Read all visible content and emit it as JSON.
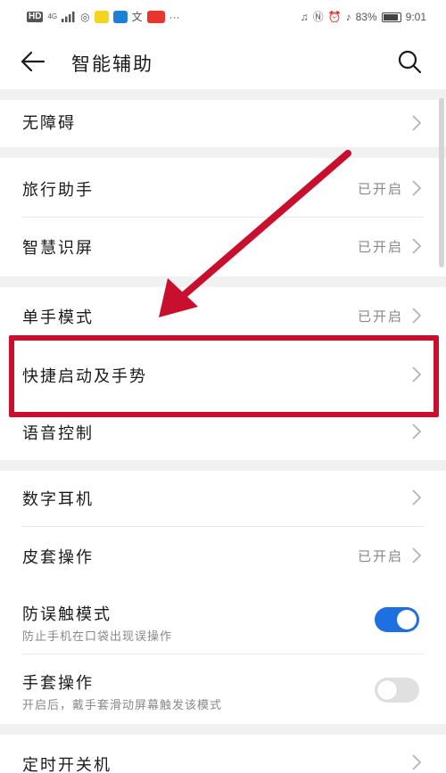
{
  "status_bar": {
    "left_text": "HD",
    "signal": "4G",
    "battery_percent": "83%",
    "time": "9:01"
  },
  "app_bar": {
    "title": "智能辅助"
  },
  "sections": [
    [
      {
        "label": "无障碍",
        "status": ""
      }
    ],
    [
      {
        "label": "旅行助手",
        "status": "已开启"
      },
      {
        "label": "智慧识屏",
        "status": "已开启"
      }
    ],
    [
      {
        "label": "单手模式",
        "status": "已开启"
      },
      {
        "label": "快捷启动及手势",
        "status": ""
      },
      {
        "label": "语音控制",
        "status": ""
      }
    ],
    [
      {
        "label": "数字耳机",
        "status": ""
      },
      {
        "label": "皮套操作",
        "status": "已开启"
      },
      {
        "label": "防误触模式",
        "subtitle": "防止手机在口袋出现误操作",
        "toggle": true
      },
      {
        "label": "手套操作",
        "subtitle": "开启后，戴手套滑动屏幕触发该模式",
        "toggle": false
      }
    ],
    [
      {
        "label": "定时开关机",
        "status": ""
      }
    ]
  ],
  "colors": {
    "accent": "#1f6fe0",
    "annotation": "#c8102e",
    "section_gap": "#f1f1f1"
  }
}
